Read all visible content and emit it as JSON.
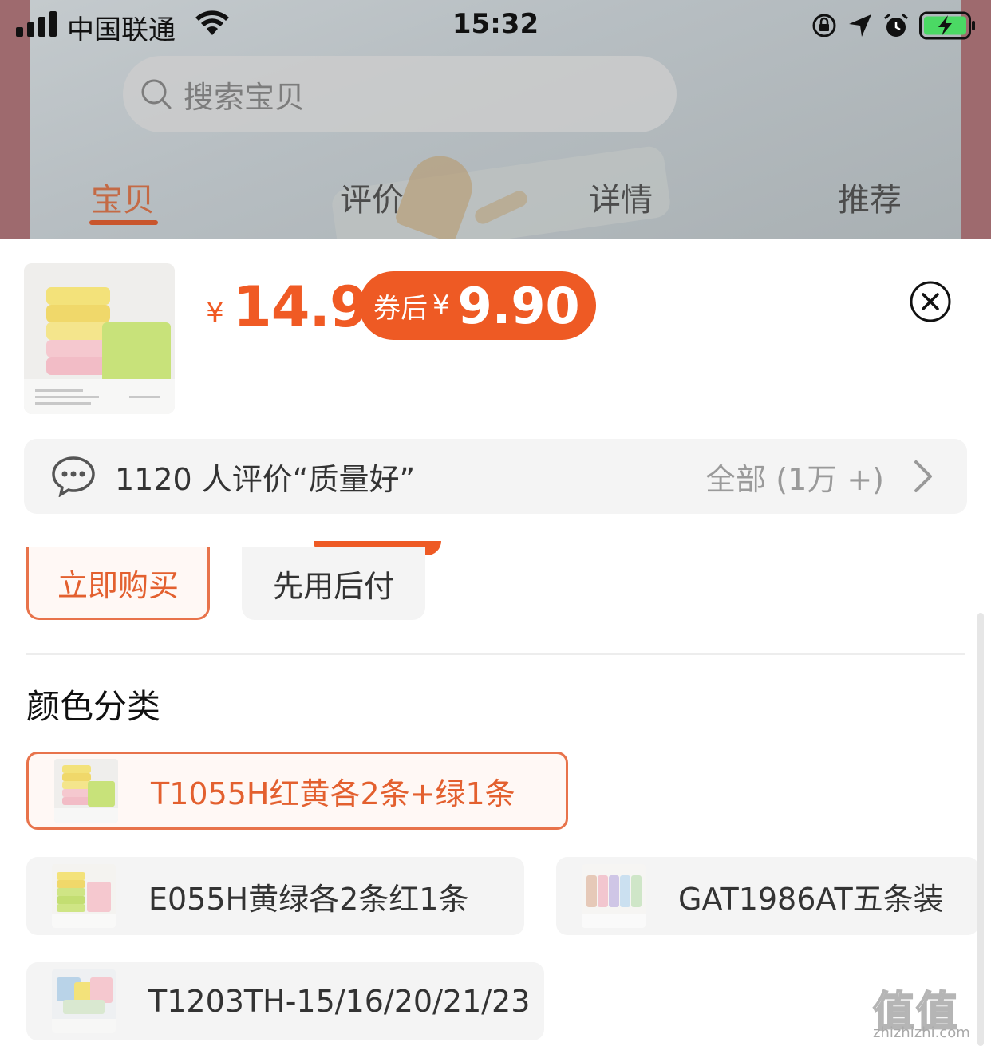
{
  "status_bar": {
    "carrier": "中国联通",
    "time": "15:32"
  },
  "header": {
    "search_placeholder": "搜索宝贝",
    "tabs": [
      {
        "label": "宝贝",
        "active": true
      },
      {
        "label": "评价",
        "active": false
      },
      {
        "label": "详情",
        "active": false
      },
      {
        "label": "推荐",
        "active": false
      }
    ]
  },
  "sheet": {
    "currency_symbol": "¥",
    "price": "14.9",
    "coupon": {
      "label": "券后",
      "symbol": "¥",
      "price": "9.90"
    },
    "review": {
      "summary": "1120 人评价“质量好”",
      "all_label": "全部 (1万 +)"
    },
    "buttons": {
      "buy_now": "立即购买",
      "pay_later": "先用后付"
    },
    "color_section": {
      "title": "颜色分类",
      "options": [
        {
          "label": "T1055H红黄各2条+绿1条",
          "selected": true
        },
        {
          "label": "E055H黄绿各2条红1条",
          "selected": false
        },
        {
          "label": "GAT1986AT五条装",
          "selected": false
        },
        {
          "label": "T1203TH-15/16/20/21/23",
          "selected": false
        }
      ]
    }
  },
  "colors": {
    "accent": "#f05a24",
    "accent_border": "#e8734b",
    "option_bg": "#f4f4f4"
  },
  "watermark": {
    "glyphs": "值",
    "url": "zhizhizhi.com"
  }
}
